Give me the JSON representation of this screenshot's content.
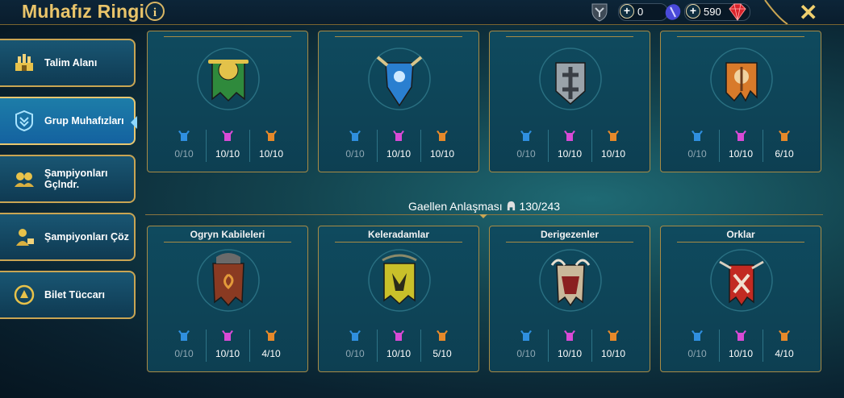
{
  "header": {
    "title": "Muhafız Ringi",
    "info_icon": "i",
    "currencies": [
      {
        "name": "silver-icon",
        "value": "0"
      },
      {
        "name": "energy-icon",
        "value": "590"
      }
    ],
    "close_icon": "✕"
  },
  "sidebar": {
    "items": [
      {
        "label": "Talim Alanı",
        "icon": "arena-icon",
        "active": false
      },
      {
        "label": "Grup Muhafızları",
        "icon": "faction-guardians-icon",
        "active": true
      },
      {
        "label": "Şampiyonları Gçlndr.",
        "icon": "upgrade-champions-icon",
        "active": false
      },
      {
        "label": "Şampiyonları Çöz",
        "icon": "unlock-champions-icon",
        "active": false
      },
      {
        "label": "Bilet Tüccarı",
        "icon": "ticket-merchant-icon",
        "active": false
      }
    ]
  },
  "group": {
    "label": "Gaellen Anlaşması",
    "progress": "130/243"
  },
  "colors": {
    "rare": "#2f8fe0",
    "epic": "#d94ad6",
    "legendary": "#e6892a",
    "gold": "#c9a553"
  },
  "top_cards": [
    {
      "title": "",
      "banner": "#2f8a3c",
      "accent": "#e3c24a",
      "counts": [
        "0/10",
        "10/10",
        "10/10"
      ]
    },
    {
      "title": "",
      "banner": "#2a7fd0",
      "accent": "#d9c58a",
      "counts": [
        "0/10",
        "10/10",
        "10/10"
      ]
    },
    {
      "title": "",
      "banner": "#9aa3aa",
      "accent": "#3a3f46",
      "counts": [
        "0/10",
        "10/10",
        "10/10"
      ]
    },
    {
      "title": "",
      "banner": "#d87a2a",
      "accent": "#f1d3a0",
      "counts": [
        "0/10",
        "10/10",
        "6/10"
      ]
    }
  ],
  "bottom_cards": [
    {
      "title": "Ogryn Kabileleri",
      "banner": "#8a3a22",
      "accent": "#e39a3a",
      "counts": [
        "0/10",
        "10/10",
        "4/10"
      ]
    },
    {
      "title": "Keleradamlar",
      "banner": "#c9c02a",
      "accent": "#2b2b1a",
      "counts": [
        "0/10",
        "10/10",
        "5/10"
      ]
    },
    {
      "title": "Derigezenler",
      "banner": "#c9b89a",
      "accent": "#8a2020",
      "counts": [
        "0/10",
        "10/10",
        "10/10"
      ]
    },
    {
      "title": "Orklar",
      "banner": "#c22a22",
      "accent": "#f0e0d0",
      "counts": [
        "0/10",
        "10/10",
        "4/10"
      ]
    }
  ]
}
